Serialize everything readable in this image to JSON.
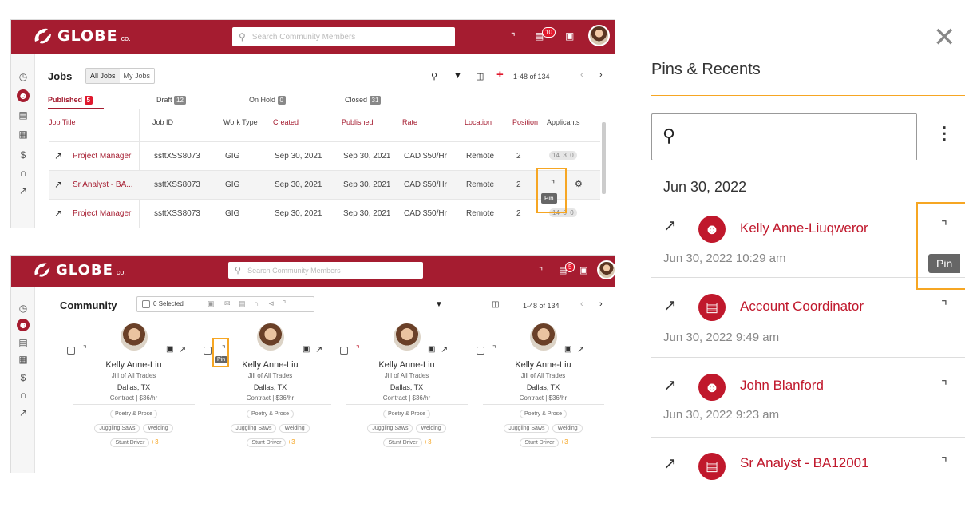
{
  "app": {
    "brand": "GLOBE",
    "brand_suffix": "co.",
    "search_placeholder": "Search Community Members",
    "notification_count": "10",
    "notification_count_2": "5"
  },
  "jobs": {
    "title": "Jobs",
    "toggle": [
      "All Jobs",
      "My Jobs"
    ],
    "pagination": "1-48 of 134",
    "tabs": [
      {
        "label": "Published",
        "count": "5"
      },
      {
        "label": "Draft",
        "count": "12"
      },
      {
        "label": "On Hold",
        "count": "0"
      },
      {
        "label": "Closed",
        "count": "31"
      }
    ],
    "columns": [
      "Job Title",
      "Job ID",
      "Work Type",
      "Created",
      "Published",
      "Rate",
      "Location",
      "Position",
      "Applicants"
    ],
    "rows": [
      {
        "title": "Project Manager",
        "id": "ssttXSS8073",
        "type": "GIG",
        "created": "Sep 30, 2021",
        "published": "Sep 30, 2021",
        "rate": "CAD $50/Hr",
        "location": "Remote",
        "position": "2",
        "a1": "14",
        "a2": "3",
        "a3": "0"
      },
      {
        "title": "Sr Analyst - BA...",
        "id": "ssttXSS8073",
        "type": "GIG",
        "created": "Sep 30, 2021",
        "published": "Sep 30, 2021",
        "rate": "CAD $50/Hr",
        "location": "Remote",
        "position": "2"
      },
      {
        "title": "Project Manager",
        "id": "ssttXSS8073",
        "type": "GIG",
        "created": "Sep 30, 2021",
        "published": "Sep 30, 2021",
        "rate": "CAD $50/Hr",
        "location": "Remote",
        "position": "2",
        "a1": "14",
        "a2": "3",
        "a3": "0"
      }
    ],
    "pin_tooltip": "Pin"
  },
  "community": {
    "title": "Community",
    "selected": "0 Selected",
    "pagination": "1-48 of 134",
    "pin_tooltip": "Pin",
    "card": {
      "name": "Kelly Anne-Liu",
      "headline": "Jill of All Trades",
      "location": "Dallas, TX",
      "contract": "Contract | $36/hr",
      "tags_1": "Poetry & Prose",
      "tags_2a": "Juggling Saws",
      "tags_2b": "Welding",
      "tags_3": "Stunt Driver",
      "more": "+3"
    }
  },
  "pins": {
    "title": "Pins & Recents",
    "date_header": "Jun 30, 2022",
    "tooltip": "Pin",
    "items": [
      {
        "title": "Kelly Anne-Liuqweror",
        "date": "Jun 30, 2022 10:29 am",
        "icon": "person-icon"
      },
      {
        "title": "Account Coordinator",
        "date": "Jun 30, 2022 9:49 am",
        "icon": "briefcase-icon"
      },
      {
        "title": "John Blanford",
        "date": "Jun 30, 2022 9:23 am",
        "icon": "person-icon"
      },
      {
        "title": "Sr Analyst - BA12001",
        "date": "",
        "icon": "briefcase-icon"
      }
    ]
  }
}
